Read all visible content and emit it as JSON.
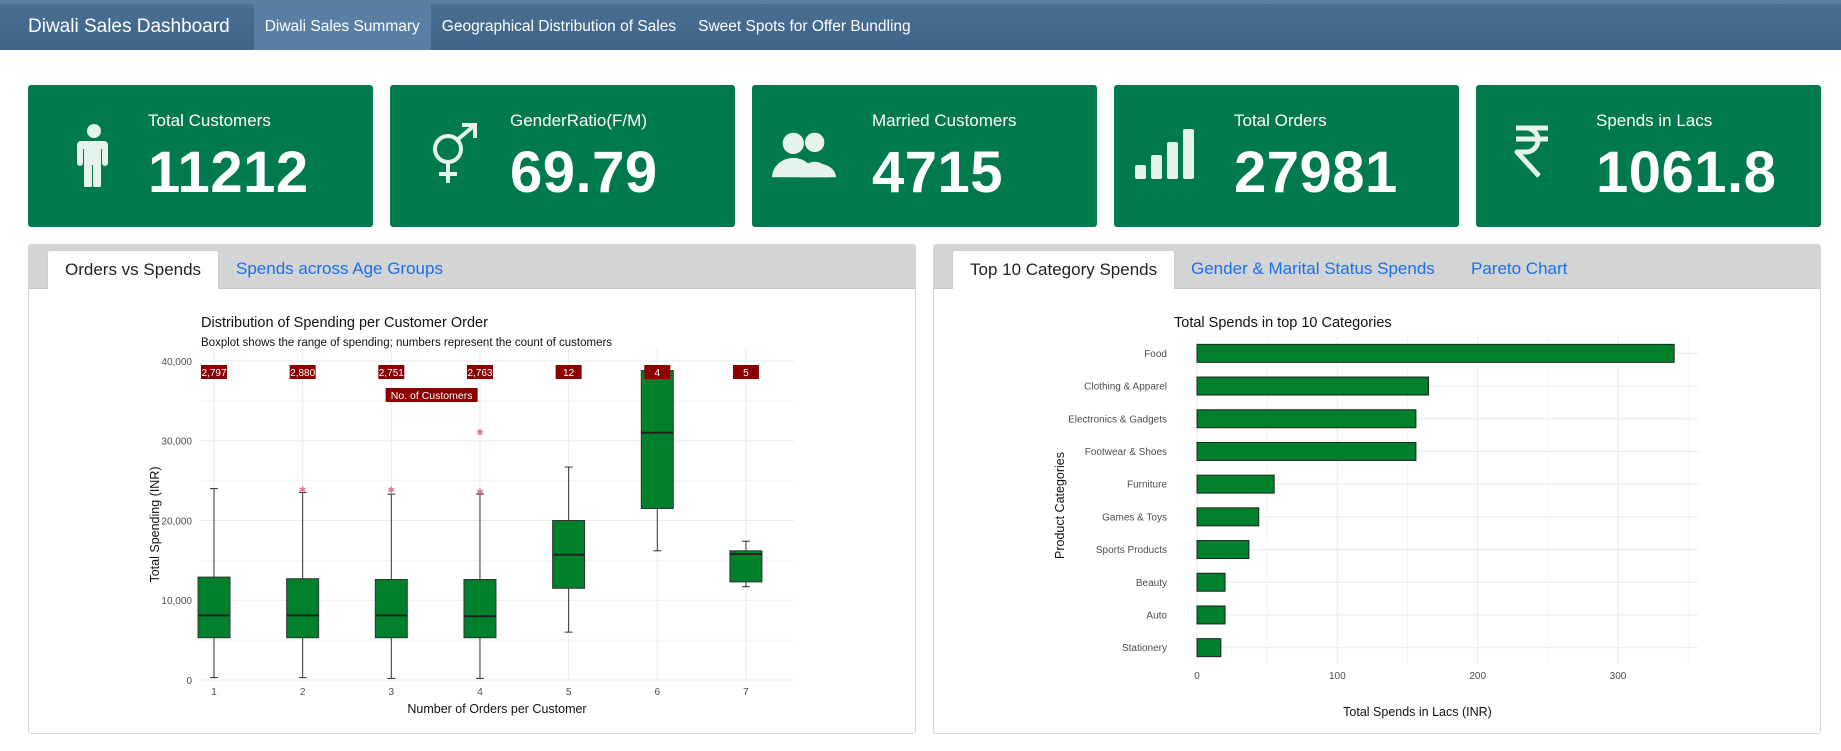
{
  "navbar": {
    "brand": "Diwali Sales Dashboard",
    "tabs": [
      {
        "label": "Diwali Sales Summary",
        "active": true
      },
      {
        "label": "Geographical Distribution of Sales",
        "active": false
      },
      {
        "label": "Sweet Spots for Offer Bundling",
        "active": false
      }
    ]
  },
  "colors": {
    "navbar": "#44698e",
    "value_box": "#007a4d",
    "bar": "#00802b",
    "label_bg": "#8b0000",
    "tab_link": "#1e6ee6"
  },
  "value_boxes": [
    {
      "label": "Total Customers",
      "value": "11212",
      "icon": "person-icon"
    },
    {
      "label": "GenderRatio(F/M)",
      "value": "69.79",
      "icon": "gender-icon"
    },
    {
      "label": "Married Customers",
      "value": "4715",
      "icon": "users-icon"
    },
    {
      "label": "Total Orders",
      "value": "27981",
      "icon": "signal-bars-icon"
    },
    {
      "label": "Spends in Lacs",
      "value": "1061.8",
      "icon": "rupee-icon"
    }
  ],
  "left_panel": {
    "tabs": [
      {
        "label": "Orders vs Spends",
        "active": true
      },
      {
        "label": "Spends across Age Groups",
        "active": false
      }
    ]
  },
  "right_panel": {
    "tabs": [
      {
        "label": "Top 10 Category Spends",
        "active": true
      },
      {
        "label": "Gender & Marital Status Spends",
        "active": false
      },
      {
        "label": "Pareto Chart",
        "active": false
      }
    ]
  },
  "chart_data": [
    {
      "type": "boxplot",
      "title": "Distribution of Spending per Customer Order",
      "subtitle": "Boxplot shows the range of spending; numbers represent the count of customers",
      "xlabel": "Number of Orders per Customer",
      "ylabel": "Total Spending (INR)",
      "annotation": "No. of Customers",
      "ylim": [
        0,
        41500
      ],
      "yticks": [
        0,
        10000,
        20000,
        30000,
        40000
      ],
      "ytick_labels": [
        "0",
        "10,000",
        "20,000",
        "30,000",
        "40,000"
      ],
      "grid": true,
      "categories": [
        "1",
        "2",
        "3",
        "4",
        "5",
        "6",
        "7"
      ],
      "counts": [
        "2,797",
        "2,880",
        "2,751",
        "2,763",
        "12",
        "4",
        "5"
      ],
      "boxes": [
        {
          "whisker_low": 300,
          "q1": 5300,
          "median": 8100,
          "q3": 12900,
          "whisker_high": 24000,
          "outliers": []
        },
        {
          "whisker_low": 300,
          "q1": 5300,
          "median": 8100,
          "q3": 12700,
          "whisker_high": 23500,
          "outliers": [
            23800
          ]
        },
        {
          "whisker_low": 200,
          "q1": 5300,
          "median": 8100,
          "q3": 12600,
          "whisker_high": 23300,
          "outliers": [
            23800
          ]
        },
        {
          "whisker_low": 200,
          "q1": 5300,
          "median": 8000,
          "q3": 12600,
          "whisker_high": 23300,
          "outliers": [
            23600,
            31000
          ]
        },
        {
          "whisker_low": 6000,
          "q1": 11500,
          "median": 15700,
          "q3": 20000,
          "whisker_high": 26700,
          "outliers": []
        },
        {
          "whisker_low": 16200,
          "q1": 21500,
          "median": 31000,
          "q3": 38800,
          "whisker_high": 39300,
          "outliers": []
        },
        {
          "whisker_low": 11700,
          "q1": 12300,
          "median": 15800,
          "q3": 16200,
          "whisker_high": 17400,
          "outliers": []
        }
      ]
    },
    {
      "type": "bar",
      "orientation": "horizontal",
      "title": "Total Spends in top 10 Categories",
      "xlabel": "Total Spends in Lacs (INR)",
      "ylabel": "Product Categories",
      "xlim": [
        0,
        357
      ],
      "xticks": [
        0,
        100,
        200,
        300
      ],
      "grid": true,
      "categories": [
        "Food",
        "Clothing & Apparel",
        "Electronics & Gadgets",
        "Footwear & Shoes",
        "Furniture",
        "Games & Toys",
        "Sports Products",
        "Beauty",
        "Auto",
        "Stationery"
      ],
      "values": [
        340,
        165,
        156,
        156,
        55,
        44,
        37,
        20,
        20,
        17
      ]
    }
  ]
}
